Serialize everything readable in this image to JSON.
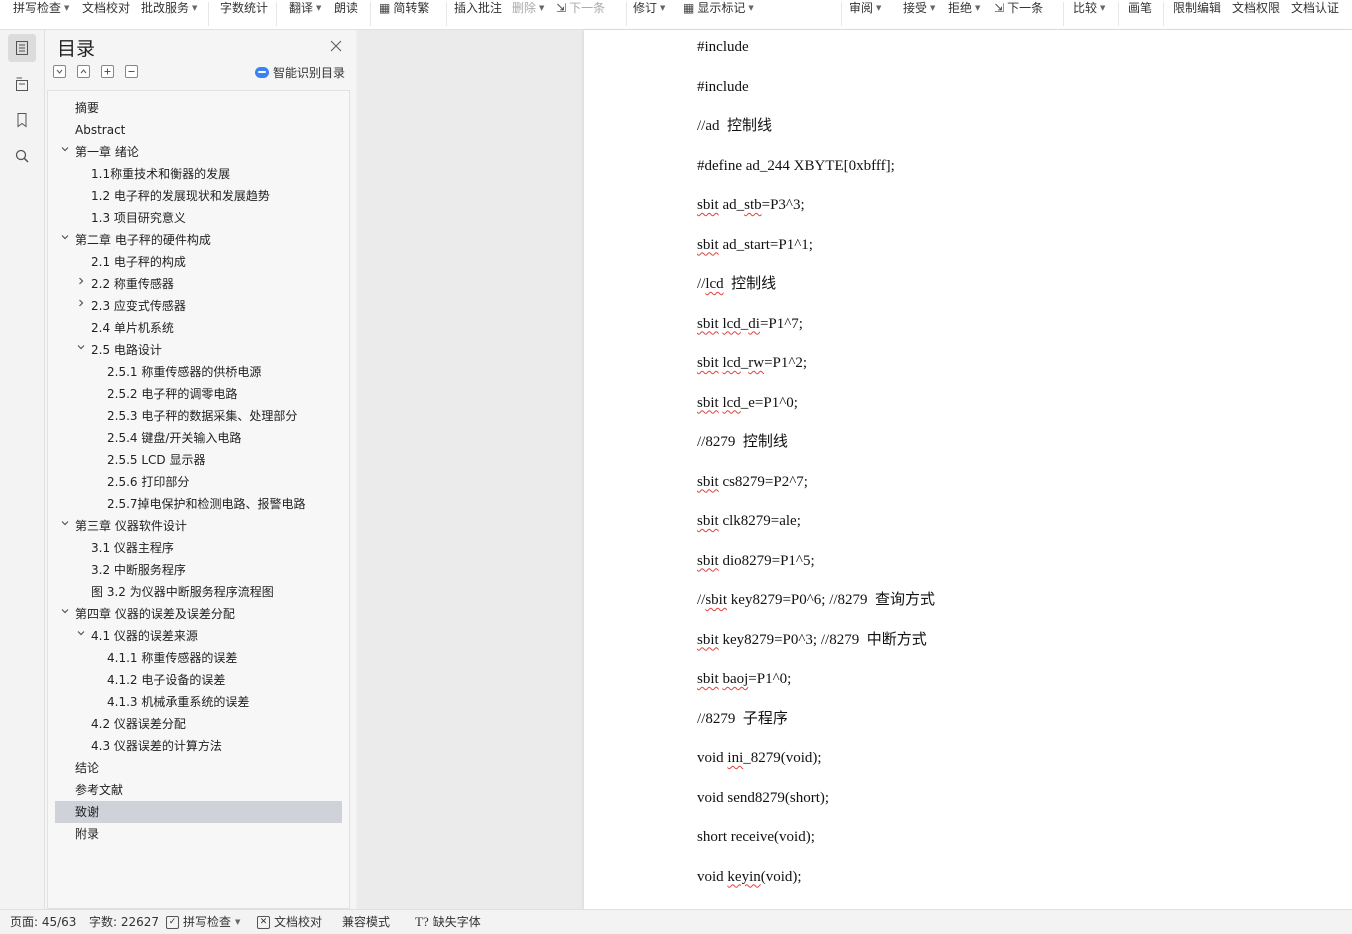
{
  "ribbon": {
    "items": [
      {
        "label": "拼写检查",
        "caret": true
      },
      {
        "label": "文档校对",
        "caret": false
      },
      {
        "label": "批改服务",
        "caret": true
      },
      {
        "label": "字数统计",
        "caret": false
      },
      {
        "label": "翻译",
        "caret": true
      },
      {
        "label": "朗读",
        "caret": false
      },
      {
        "label": "简转繁",
        "caret": false
      },
      {
        "label": "插入批注",
        "caret": false
      },
      {
        "label": "删除",
        "caret": true
      },
      {
        "label": "下一条",
        "caret": false
      },
      {
        "label": "修订",
        "caret": true
      },
      {
        "label": "显示标记",
        "caret": true
      },
      {
        "label": "审阅",
        "caret": true
      },
      {
        "label": "接受",
        "caret": true
      },
      {
        "label": "拒绝",
        "caret": true
      },
      {
        "label": "下一条",
        "caret": false
      },
      {
        "label": "比较",
        "caret": true
      },
      {
        "label": "画笔",
        "caret": false
      },
      {
        "label": "限制编辑",
        "caret": false
      },
      {
        "label": "文档权限",
        "caret": false
      },
      {
        "label": "文档认证",
        "caret": false
      }
    ]
  },
  "toc": {
    "title": "目录",
    "smart_label": "智能识别目录",
    "items": [
      {
        "label": "摘要",
        "level": 1,
        "chevron": ""
      },
      {
        "label": "Abstract",
        "level": 1,
        "chevron": ""
      },
      {
        "label": "第一章  绪论",
        "level": 1,
        "chevron": "down"
      },
      {
        "label": "1.1称重技术和衡器的发展",
        "level": 2,
        "chevron": ""
      },
      {
        "label": "1.2 电子秤的发展现状和发展趋势",
        "level": 2,
        "chevron": ""
      },
      {
        "label": "1.3 项目研究意义",
        "level": 2,
        "chevron": ""
      },
      {
        "label": "第二章   电子秤的硬件构成",
        "level": 1,
        "chevron": "down"
      },
      {
        "label": "2.1     电子秤的构成",
        "level": 2,
        "chevron": ""
      },
      {
        "label": "2.2    称重传感器",
        "level": 2,
        "chevron": "right"
      },
      {
        "label": "2.3    应变式传感器",
        "level": 2,
        "chevron": "right"
      },
      {
        "label": "2.4    单片机系统",
        "level": 2,
        "chevron": ""
      },
      {
        "label": "2.5    电路设计",
        "level": 2,
        "chevron": "down"
      },
      {
        "label": "2.5.1      称重传感器的供桥电源",
        "level": 3,
        "chevron": ""
      },
      {
        "label": "2.5.2      电子秤的调零电路",
        "level": 3,
        "chevron": ""
      },
      {
        "label": "2.5.3    电子秤的数据采集、处理部分",
        "level": 3,
        "chevron": ""
      },
      {
        "label": "2.5.4  键盘/开关输入电路",
        "level": 3,
        "chevron": ""
      },
      {
        "label": "2.5.5     LCD 显示器",
        "level": 3,
        "chevron": ""
      },
      {
        "label": "2.5.6   打印部分",
        "level": 3,
        "chevron": ""
      },
      {
        "label": "2.5.7掉电保护和检测电路、报警电路",
        "level": 3,
        "chevron": ""
      },
      {
        "label": "第三章    仪器软件设计",
        "level": 1,
        "chevron": "down"
      },
      {
        "label": "3.1  仪器主程序",
        "level": 2,
        "chevron": ""
      },
      {
        "label": "3.2  中断服务程序",
        "level": 2,
        "chevron": ""
      },
      {
        "label": "图 3.2 为仪器中断服务程序流程图",
        "level": 2,
        "chevron": ""
      },
      {
        "label": "第四章      仪器的误差及误差分配",
        "level": 1,
        "chevron": "down"
      },
      {
        "label": "4.1  仪器的误差来源",
        "level": 2,
        "chevron": "down"
      },
      {
        "label": "4.1.1  称重传感器的误差",
        "level": 3,
        "chevron": ""
      },
      {
        "label": "4.1.2    电子设备的误差",
        "level": 3,
        "chevron": ""
      },
      {
        "label": "4.1.3  机械承重系统的误差",
        "level": 3,
        "chevron": ""
      },
      {
        "label": "4.2    仪器误差分配",
        "level": 2,
        "chevron": ""
      },
      {
        "label": "4.3    仪器误差的计算方法",
        "level": 2,
        "chevron": ""
      },
      {
        "label": "结论",
        "level": 1,
        "chevron": ""
      },
      {
        "label": "参考文献",
        "level": 1,
        "chevron": ""
      },
      {
        "label": "致谢",
        "level": 1,
        "chevron": "",
        "selected": true
      },
      {
        "label": "附录",
        "level": 1,
        "chevron": ""
      }
    ]
  },
  "document": {
    "lines": [
      [
        {
          "t": "#include"
        }
      ],
      [
        {
          "t": "#include"
        }
      ],
      [
        {
          "t": "//ad  控制线"
        }
      ],
      [
        {
          "t": "#define ad_244 XBYTE[0xbfff];"
        }
      ],
      [
        {
          "t": "sbit",
          "w": true
        },
        {
          "t": " ad_"
        },
        {
          "t": "stb",
          "w": true
        },
        {
          "t": "=P3^3;"
        }
      ],
      [
        {
          "t": "sbit",
          "w": true
        },
        {
          "t": " ad_start=P1^1;"
        }
      ],
      [
        {
          "t": "//"
        },
        {
          "t": "lcd",
          "w": true
        },
        {
          "t": "  控制线"
        }
      ],
      [
        {
          "t": "sbit",
          "w": true
        },
        {
          "t": " "
        },
        {
          "t": "lcd",
          "w": true
        },
        {
          "t": "_"
        },
        {
          "t": "di",
          "w": true
        },
        {
          "t": "=P1^7;"
        }
      ],
      [
        {
          "t": "sbit",
          "w": true
        },
        {
          "t": " "
        },
        {
          "t": "lcd",
          "w": true
        },
        {
          "t": "_"
        },
        {
          "t": "rw",
          "w": true
        },
        {
          "t": "=P1^2;"
        }
      ],
      [
        {
          "t": "sbit",
          "w": true
        },
        {
          "t": " "
        },
        {
          "t": "lcd",
          "w": true
        },
        {
          "t": "_e=P1^0;"
        }
      ],
      [
        {
          "t": "//8279  控制线"
        }
      ],
      [
        {
          "t": "sbit",
          "w": true
        },
        {
          "t": " cs8279=P2^7;"
        }
      ],
      [
        {
          "t": "sbit",
          "w": true
        },
        {
          "t": " clk8279=ale;"
        }
      ],
      [
        {
          "t": "sbit",
          "w": true
        },
        {
          "t": " dio8279=P1^5;"
        }
      ],
      [
        {
          "t": "//"
        },
        {
          "t": "sbit",
          "w": true
        },
        {
          "t": " key8279=P0^6; //8279  查询方式"
        }
      ],
      [
        {
          "t": "sbit",
          "w": true
        },
        {
          "t": " key8279=P0^3; //8279  中断方式"
        }
      ],
      [
        {
          "t": "sbit",
          "w": true
        },
        {
          "t": " "
        },
        {
          "t": "baoj",
          "w": true
        },
        {
          "t": "=P1^0;"
        }
      ],
      [
        {
          "t": "//8279  子程序"
        }
      ],
      [
        {
          "t": "void "
        },
        {
          "t": "ini",
          "w": true
        },
        {
          "t": "_8279(void);"
        }
      ],
      [
        {
          "t": "void send8279(short);"
        }
      ],
      [
        {
          "t": "short receive(void);"
        }
      ],
      [
        {
          "t": "void "
        },
        {
          "t": "keyin",
          "w": true
        },
        {
          "t": "(void);"
        }
      ]
    ]
  },
  "status": {
    "page": "页面: 45/63",
    "words": "字数: 22627",
    "spell_check": "拼写检查",
    "doc_proof": "文档校对",
    "compat_mode": "兼容模式",
    "missing_fonts": "缺失字体"
  },
  "colors": {
    "selected_row": "#cfd3d9",
    "smart_accent": "#3b82f6",
    "spell_underline": "#e04040"
  }
}
